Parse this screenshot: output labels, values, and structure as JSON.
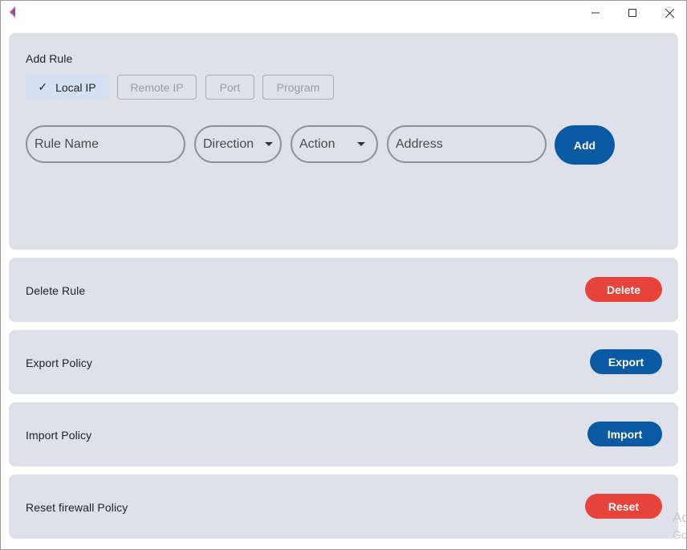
{
  "window": {
    "minimize_glyph": "—",
    "maximize_glyph": "☐",
    "close_glyph": "✕",
    "icons": [
      "app-logo-icon",
      "minimize-icon",
      "maximize-icon",
      "close-icon"
    ]
  },
  "add_rule": {
    "title": "Add Rule",
    "chips": [
      {
        "label": "Local IP",
        "selected": true
      },
      {
        "label": "Remote IP",
        "selected": false
      },
      {
        "label": "Port",
        "selected": false
      },
      {
        "label": "Program",
        "selected": false
      }
    ],
    "check_glyph": "✓",
    "rule_name_placeholder": "Rule Name",
    "direction_label": "Direction",
    "action_label": "Action",
    "address_placeholder": "Address",
    "add_label": "Add"
  },
  "delete_rule": {
    "title": "Delete Rule",
    "button_label": "Delete"
  },
  "export_policy": {
    "title": "Export Policy",
    "button_label": "Export"
  },
  "import_policy": {
    "title": "Import Policy",
    "button_label": "Import"
  },
  "reset_policy": {
    "title": "Reset firewall Policy",
    "button_label": "Reset"
  },
  "watermark": {
    "line1": "Ac",
    "line2": "Go"
  },
  "colors": {
    "card_bg": "#dfe1ea",
    "primary_blue": "#0a5aa3",
    "danger_red": "#e8433b",
    "chip_selected_bg": "#d5e0f2"
  }
}
